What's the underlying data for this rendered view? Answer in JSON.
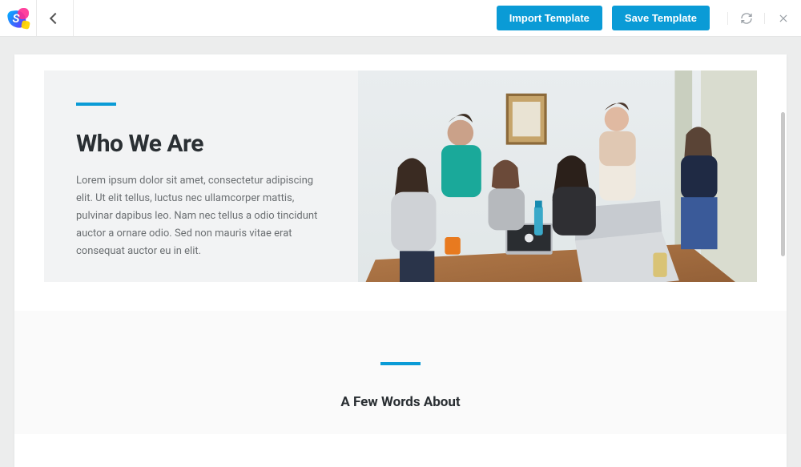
{
  "toolbar": {
    "import_label": "Import Template",
    "save_label": "Save Template"
  },
  "hero": {
    "title": "Who We Are",
    "body": "Lorem ipsum dolor sit amet, consectetur adipiscing elit. Ut elit tellus, luctus nec ullamcorper mattis, pulvinar dapibus leo. Nam nec tellus a odio tincidunt auctor a ornare odio. Sed non mauris vitae erat consequat auctor eu in elit."
  },
  "about": {
    "title": "A Few Words About"
  },
  "colors": {
    "accent": "#0a9bd6"
  }
}
